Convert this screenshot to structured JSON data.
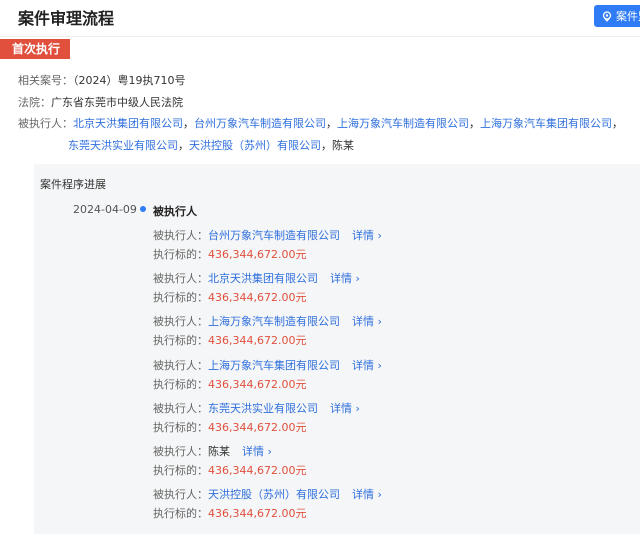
{
  "header": {
    "title": "案件审理流程",
    "monitor_label": "案件监"
  },
  "section_label": "首次执行",
  "info": {
    "case_no_label": "相关案号：",
    "case_no_value": "（2024）粤19执710号",
    "court_label": "法院：",
    "court_value": "广东省东莞市中级人民法院",
    "executed_label": "被执行人：",
    "executed_line1": [
      "北京天洪集团有限公司",
      "台州万象汽车制造有限公司",
      "上海万象汽车制造有限公司",
      "上海万象汽车集团有限公司"
    ],
    "executed_line2": [
      "东莞天洪实业有限公司",
      "天洪控股（苏州）有限公司"
    ],
    "executed_last": "陈某",
    "separator": "，"
  },
  "progress": {
    "title": "案件程序进展",
    "date": "2024-04-09",
    "event": "被执行人",
    "party_label": "被执行人：",
    "amount_label": "执行标的：",
    "detail_label": "详情",
    "entries": [
      {
        "party": "台州万象汽车制造有限公司",
        "amount": "436,344,672.00元"
      },
      {
        "party": "北京天洪集团有限公司",
        "amount": "436,344,672.00元"
      },
      {
        "party": "上海万象汽车制造有限公司",
        "amount": "436,344,672.00元"
      },
      {
        "party": "上海万象汽车集团有限公司",
        "amount": "436,344,672.00元"
      },
      {
        "party": "东莞天洪实业有限公司",
        "amount": "436,344,672.00元"
      },
      {
        "party": "陈某",
        "amount": "436,344,672.00元"
      },
      {
        "party": "天洪控股（苏州）有限公司",
        "amount": "436,344,672.00元"
      }
    ]
  }
}
